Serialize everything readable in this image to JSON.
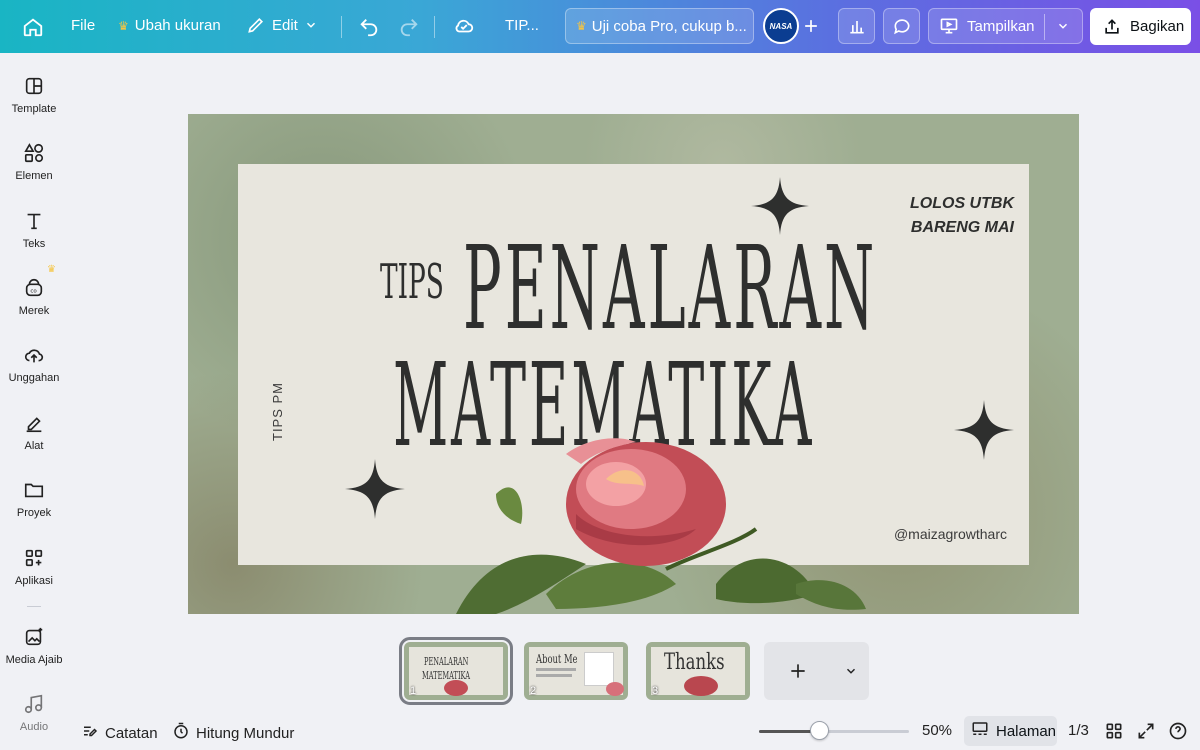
{
  "topbar": {
    "file": "File",
    "resize": "Ubah ukuran",
    "edit": "Edit",
    "doc_title": "TIP...",
    "trial": "Uji coba Pro, cukup b...",
    "avatar_text": "NASA",
    "present": "Tampilkan",
    "share": "Bagikan"
  },
  "sidebar": {
    "items": [
      {
        "label": "Template"
      },
      {
        "label": "Elemen"
      },
      {
        "label": "Teks"
      },
      {
        "label": "Merek"
      },
      {
        "label": "Unggahan"
      },
      {
        "label": "Alat"
      },
      {
        "label": "Proyek"
      },
      {
        "label": "Aplikasi"
      },
      {
        "label": "Media Ajaib"
      },
      {
        "label": "Audio"
      }
    ]
  },
  "slide": {
    "brand_line1": "LOLOS UTBK",
    "brand_line2": "BARENG MAI",
    "tips": "TIPS",
    "title_line1": "PENALARAN",
    "title_line2": "MATEMATIKA",
    "vertical": "TIPS PM",
    "handle": "@maizagrowtharc"
  },
  "thumbnails": [
    {
      "num": "1",
      "title": "PENALARAN",
      "sub": "MATEMATIKA"
    },
    {
      "num": "2",
      "title": "About Me"
    },
    {
      "num": "3",
      "title": "Thanks"
    }
  ],
  "bottombar": {
    "notes": "Catatan",
    "timer": "Hitung Mundur",
    "zoom": "50%",
    "zoom_fraction": 0.41,
    "pages": "Halaman",
    "page_count": "1/3"
  },
  "colors": {
    "accent_crown": "#f5c542",
    "ink": "#2e2f2e"
  }
}
